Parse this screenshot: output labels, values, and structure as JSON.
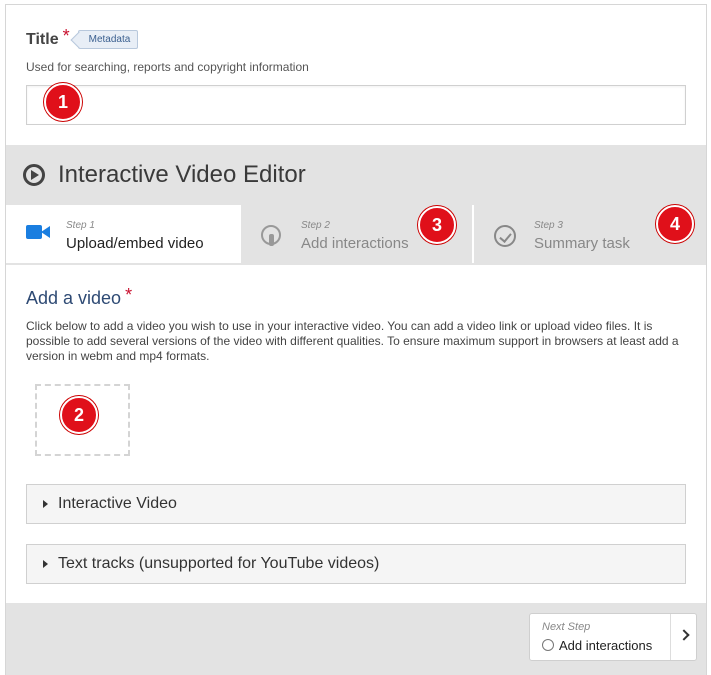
{
  "title_field": {
    "label": "Title",
    "required_mark": "*",
    "metadata_button": "Metadata",
    "description": "Used for searching, reports and copyright information",
    "value": ""
  },
  "editor": {
    "title": "Interactive Video Editor",
    "tabs": [
      {
        "step": "Step 1",
        "label": "Upload/embed video",
        "icon": "video-camera-icon",
        "active": true
      },
      {
        "step": "Step 2",
        "label": "Add interactions",
        "icon": "touch-icon",
        "active": false
      },
      {
        "step": "Step 3",
        "label": "Summary task",
        "icon": "check-circle-icon",
        "active": false
      }
    ]
  },
  "add_video": {
    "heading": "Add a video",
    "required_mark": "*",
    "description": "Click below to add a video you wish to use in your interactive video. You can add a video link or upload video files. It is possible to add several versions of the video with different qualities. To ensure maximum support in browsers at least add a version in webm and mp4 formats."
  },
  "sections": [
    {
      "label": "Interactive Video"
    },
    {
      "label": "Text tracks (unsupported for YouTube videos)"
    }
  ],
  "footer": {
    "next_step_caption": "Next Step",
    "next_step_label": "Add interactions"
  },
  "markers": [
    "1",
    "2",
    "3",
    "4"
  ],
  "colors": {
    "marker": "#e0101a",
    "heading_blue": "#2e4a74",
    "camera_blue": "#1a7ee0",
    "required_red": "#c8102e"
  }
}
